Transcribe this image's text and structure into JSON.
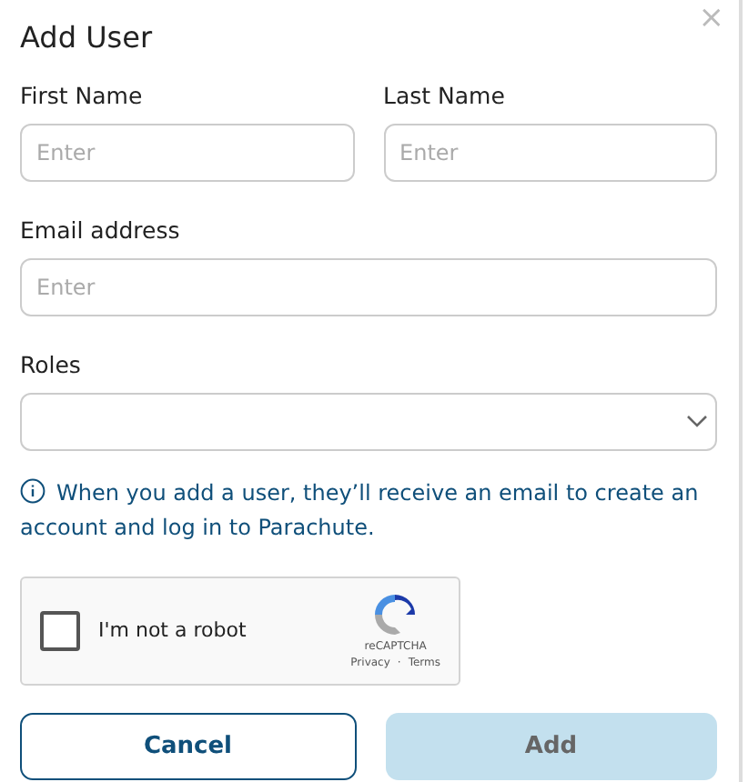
{
  "dialog": {
    "title": "Add User",
    "close": "×"
  },
  "fields": [
    {
      "label": "First Name",
      "placeholder": "Enter",
      "kind": "text"
    },
    {
      "label": "Last Name",
      "placeholder": "Enter",
      "kind": "text"
    },
    {
      "label": "Email address",
      "placeholder": "Enter",
      "kind": "text"
    },
    {
      "label": "Roles",
      "kind": "select"
    }
  ],
  "info": "When you add a user, they’ll receive an email to create an account and log in to Parachute.",
  "captcha": {
    "label": "I'm not a robot",
    "checked": false,
    "brand": "reCAPTCHA",
    "links": [
      "Privacy",
      "Terms"
    ],
    "separator": "·"
  },
  "buttons": [
    {
      "label": "Cancel",
      "kind": "outline",
      "disabled": false
    },
    {
      "label": "Add",
      "kind": "primary",
      "disabled": true
    }
  ]
}
